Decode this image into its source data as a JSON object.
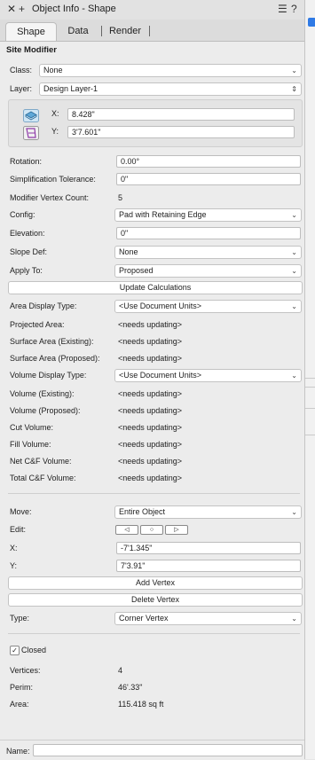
{
  "window": {
    "title": "Object Info - Shape",
    "close_glyph": "✕",
    "add_glyph": "+",
    "menu_glyph": "☰",
    "help_glyph": "?"
  },
  "tabs": [
    {
      "label": "Shape"
    },
    {
      "label": "Data"
    },
    {
      "label": "Render"
    }
  ],
  "section_title": "Site Modifier",
  "class": {
    "label": "Class:",
    "value": "None"
  },
  "layer": {
    "label": "Layer:",
    "value": "Design Layer-1"
  },
  "position": {
    "x_label": "X:",
    "x_value": "8.428\"",
    "y_label": "Y:",
    "y_value": "3'7.601\""
  },
  "fields": {
    "rotation": {
      "label": "Rotation:",
      "value": "0.00°"
    },
    "simplification": {
      "label": "Simplification Tolerance:",
      "value": "0\""
    },
    "vertex_count": {
      "label": "Modifier Vertex Count:",
      "value": "5"
    },
    "config": {
      "label": "Config:",
      "value": "Pad with Retaining Edge"
    },
    "elevation": {
      "label": "Elevation:",
      "value": "0\""
    },
    "slope_def": {
      "label": "Slope Def:",
      "value": "None"
    },
    "apply_to": {
      "label": "Apply To:",
      "value": "Proposed"
    }
  },
  "update_button": "Update Calculations",
  "area_display": {
    "label": "Area Display Type:",
    "value": "<Use Document Units>"
  },
  "areas": [
    {
      "label": "Projected Area:",
      "value": "<needs updating>"
    },
    {
      "label": "Surface Area (Existing):",
      "value": "<needs updating>"
    },
    {
      "label": "Surface Area (Proposed):",
      "value": "<needs updating>"
    }
  ],
  "volume_display": {
    "label": "Volume Display Type:",
    "value": "<Use Document Units>"
  },
  "volumes": [
    {
      "label": "Volume (Existing):",
      "value": "<needs updating>"
    },
    {
      "label": "Volume (Proposed):",
      "value": "<needs updating>"
    },
    {
      "label": "Cut Volume:",
      "value": "<needs updating>"
    },
    {
      "label": "Fill Volume:",
      "value": "<needs updating>"
    },
    {
      "label": "Net C&F Volume:",
      "value": "<needs updating>"
    },
    {
      "label": "Total C&F Volume:",
      "value": "<needs updating>"
    }
  ],
  "move": {
    "label": "Move:",
    "value": "Entire Object"
  },
  "edit": {
    "label": "Edit:"
  },
  "vertex": {
    "x_label": "X:",
    "x_value": "-7'1.345\"",
    "y_label": "Y:",
    "y_value": "7'3.91\""
  },
  "add_vertex": "Add Vertex",
  "delete_vertex": "Delete Vertex",
  "type": {
    "label": "Type:",
    "value": "Corner Vertex"
  },
  "closed": {
    "label": "Closed",
    "checked": true
  },
  "stats": [
    {
      "label": "Vertices:",
      "value": "4"
    },
    {
      "label": "Perim:",
      "value": "46'.33\""
    },
    {
      "label": "Area:",
      "value": "115.418 sq ft"
    }
  ],
  "name": {
    "label": "Name:",
    "value": ""
  }
}
